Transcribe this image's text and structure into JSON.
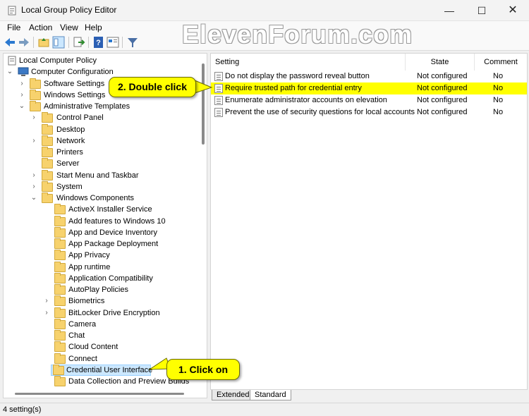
{
  "window": {
    "title": "Local Group Policy Editor",
    "minimize_glyph": "—",
    "maximize_glyph": "☐",
    "close_glyph": "✕"
  },
  "watermark": "ElevenForum.com",
  "menu": [
    "File",
    "Action",
    "View",
    "Help"
  ],
  "tree": {
    "root": "Local Computer Policy",
    "computer_configuration": "Computer Configuration",
    "software_settings": "Software Settings",
    "windows_settings": "Windows Settings",
    "administrative_templates": "Administrative Templates",
    "items": [
      "Control Panel",
      "Desktop",
      "Network",
      "Printers",
      "Server",
      "Start Menu and Taskbar",
      "System",
      "Windows Components"
    ],
    "components": [
      "ActiveX Installer Service",
      "Add features to Windows 10",
      "App and Device Inventory",
      "App Package Deployment",
      "App Privacy",
      "App runtime",
      "Application Compatibility",
      "AutoPlay Policies",
      "Biometrics",
      "BitLocker Drive Encryption",
      "Camera",
      "Chat",
      "Cloud Content",
      "Connect",
      "Credential User Interface",
      "Data Collection and Preview Builds"
    ],
    "selected": "Credential User Interface"
  },
  "list": {
    "headers": {
      "setting": "Setting",
      "state": "State",
      "comment": "Comment"
    },
    "rows": [
      {
        "setting": "Do not display the password reveal button",
        "state": "Not configured",
        "comment": "No"
      },
      {
        "setting": "Require trusted path for credential entry",
        "state": "Not configured",
        "comment": "No"
      },
      {
        "setting": "Enumerate administrator accounts on elevation",
        "state": "Not configured",
        "comment": "No"
      },
      {
        "setting": "Prevent the use of security questions for local accounts",
        "state": "Not configured",
        "comment": "No"
      }
    ],
    "highlighted_row": 1
  },
  "tabs": [
    "Extended",
    "Standard"
  ],
  "status": "4 setting(s)",
  "callouts": {
    "step1": "1. Click on",
    "step2": "2. Double click"
  },
  "colors": {
    "highlight": "#ffff00",
    "selection": "#cce8ff",
    "folder": "#f7d26d"
  },
  "icons": [
    "app-icon",
    "back-icon",
    "forward-icon",
    "up-folder-icon",
    "show-hide-tree-icon",
    "export-icon",
    "help-icon",
    "view-icon",
    "filter-icon",
    "policy-icon",
    "computer-icon",
    "folder-icon",
    "setting-icon"
  ]
}
